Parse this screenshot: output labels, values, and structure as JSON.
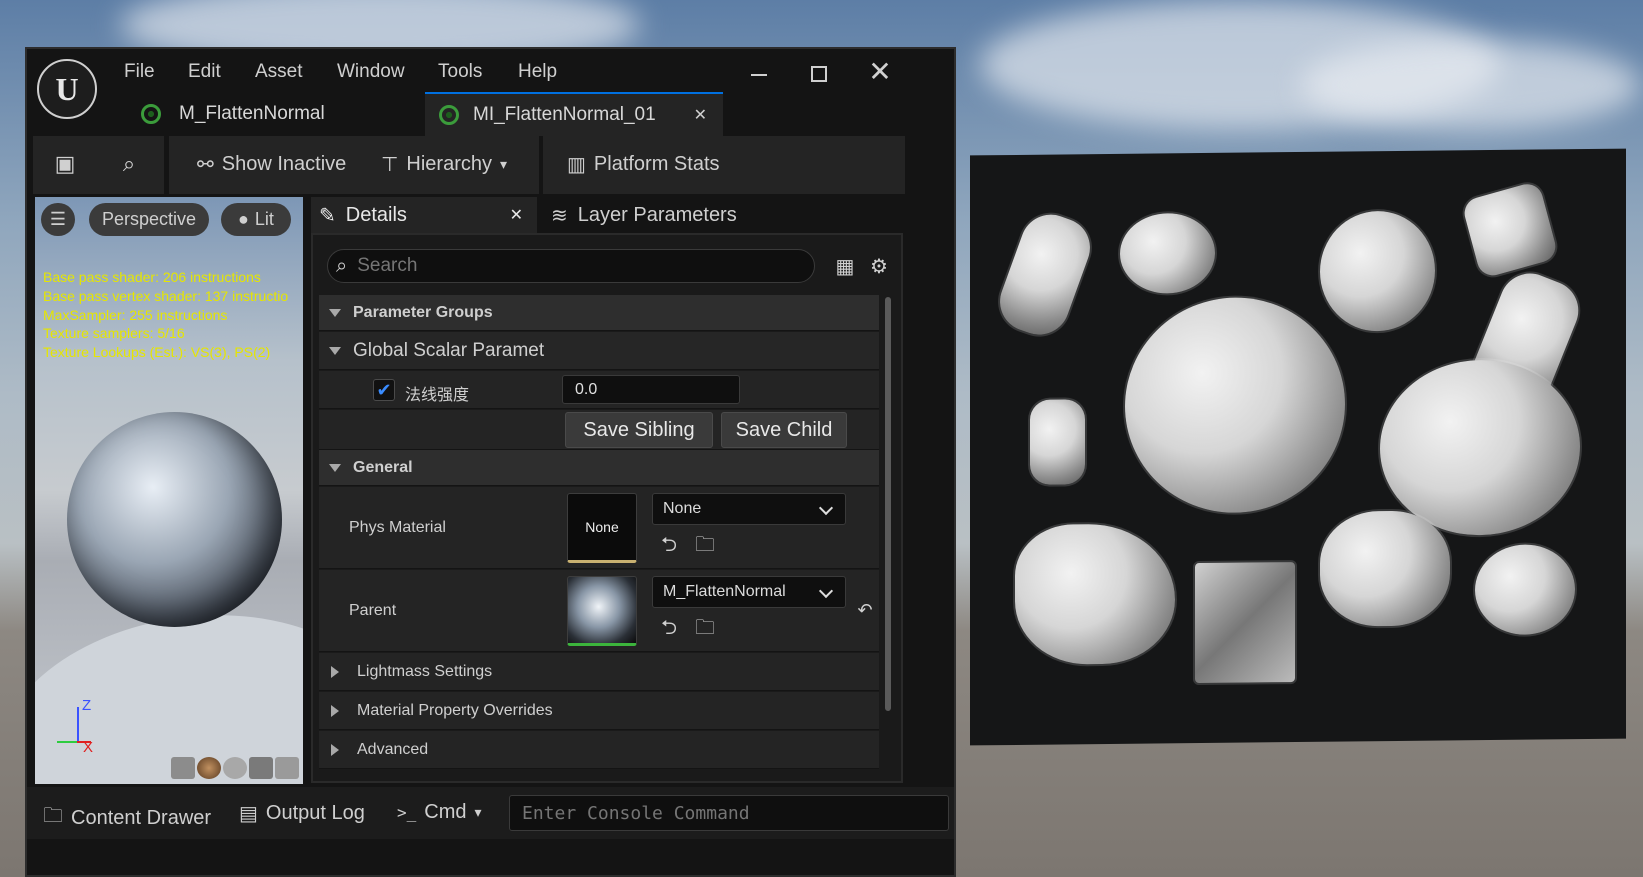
{
  "menu": [
    "File",
    "Edit",
    "Asset",
    "Window",
    "Tools",
    "Help"
  ],
  "tabs": [
    {
      "label": "M_FlattenNormal",
      "active": false
    },
    {
      "label": "MI_FlattenNormal_01",
      "active": true
    }
  ],
  "toolbar": {
    "show_inactive": "Show Inactive",
    "hierarchy": "Hierarchy",
    "platform_stats": "Platform Stats"
  },
  "viewport": {
    "view_mode": "Perspective",
    "lighting": "Lit",
    "stats": [
      "Base pass shader: 206 instructions",
      "Base pass vertex shader: 137 instructio",
      "MaxSampler: 255 instructions",
      "Texture samplers: 5/16",
      "Texture Lookups (Est.): VS(3), PS(2)"
    ],
    "axis_z": "Z",
    "axis_x": "X"
  },
  "details": {
    "tab_details": "Details",
    "tab_layers": "Layer Parameters",
    "search_placeholder": "Search",
    "group_parameter": "Parameter Groups",
    "group_scalar": "Global Scalar Paramet",
    "param_name": "法线强度",
    "param_value": "0.0",
    "param_checked": true,
    "save_sibling": "Save Sibling",
    "save_child": "Save Child",
    "group_general": "General",
    "phys_label": "Phys Material",
    "phys_thumb": "None",
    "phys_value": "None",
    "parent_label": "Parent",
    "parent_value": "M_FlattenNormal",
    "lightmass": "Lightmass Settings",
    "overrides": "Material Property Overrides",
    "advanced": "Advanced"
  },
  "bottom": {
    "content_drawer": "Content Drawer",
    "output_log": "Output Log",
    "cmd": "Cmd",
    "console_placeholder": "Enter Console Command"
  },
  "colors": {
    "accent": "#0070e0",
    "stat_text": "#e6e600",
    "active_tab_bg": "#242424"
  }
}
